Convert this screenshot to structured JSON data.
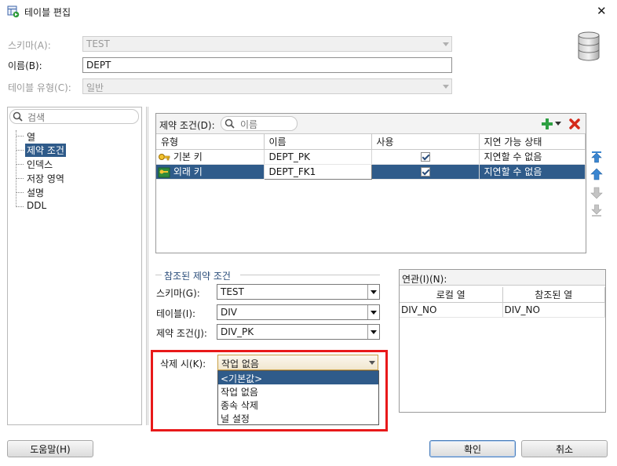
{
  "window": {
    "title": "테이블 편집",
    "close_glyph": "✕"
  },
  "form": {
    "schema_label": "스키마(A):",
    "schema_value": "TEST",
    "name_label": "이름(B):",
    "name_value": "DEPT",
    "table_type_label": "테이블 유형(C):",
    "table_type_value": "일반"
  },
  "sidebar": {
    "search_placeholder": "검색",
    "items": [
      {
        "label": "열"
      },
      {
        "label": "제약 조건",
        "selected": true
      },
      {
        "label": "인덱스"
      },
      {
        "label": "저장 영역"
      },
      {
        "label": "설명"
      },
      {
        "label": "DDL"
      }
    ]
  },
  "constraints": {
    "label": "제약 조건(D):",
    "search_placeholder": "이름",
    "columns": [
      "유형",
      "이름",
      "사용",
      "지연 가능 상태"
    ],
    "rows": [
      {
        "type": "기본 키",
        "name": "DEPT_PK",
        "enabled": true,
        "deferrable": "지연할 수 없음",
        "selected": false
      },
      {
        "type": "외래 키",
        "name": "DEPT_FK1",
        "enabled": true,
        "deferrable": "지연할 수 없음",
        "selected": true
      }
    ]
  },
  "referenced": {
    "legend": "참조된 제약 조건",
    "schema_label": "스키마(G):",
    "schema_value": "TEST",
    "table_label": "테이블(I):",
    "table_value": "DIV",
    "constraint_label": "제약 조건(J):",
    "constraint_value": "DIV_PK",
    "on_delete_label": "삭제 시(K):",
    "on_delete_value": "작업 없음",
    "on_delete_options": [
      "<기본값>",
      "작업 없음",
      "종속 삭제",
      "널 설정"
    ],
    "on_delete_highlighted": "<기본값>"
  },
  "association": {
    "label": "연관(I)(N):",
    "columns": [
      "로컬 열",
      "참조된 열"
    ],
    "rows": [
      {
        "local": "DIV_NO",
        "referenced": "DIV_NO"
      }
    ]
  },
  "footer": {
    "help": "도움말(H)",
    "ok": "확인",
    "cancel": "취소"
  },
  "colors": {
    "selection": "#2f5b8a",
    "highlight_border": "#e8191a",
    "add": "#2ea043",
    "remove": "#d42a1a"
  }
}
